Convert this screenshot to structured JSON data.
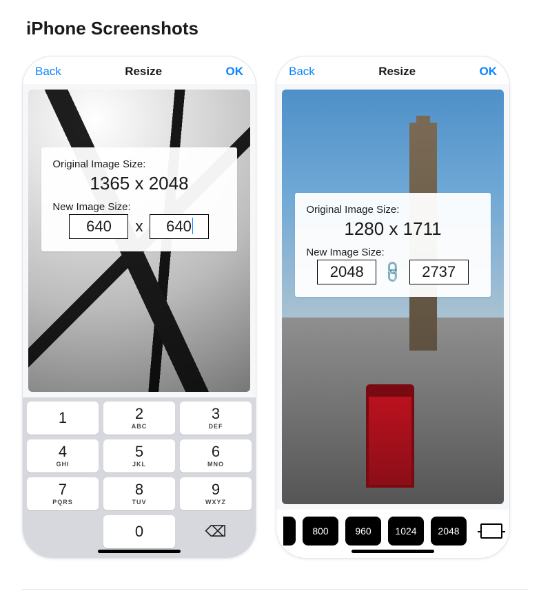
{
  "page": {
    "heading": "iPhone Screenshots"
  },
  "nav": {
    "back": "Back",
    "title": "Resize",
    "ok": "OK"
  },
  "panel": {
    "original_label": "Original Image Size:",
    "new_label": "New Image Size:",
    "x_separator": "x",
    "link_glyph": "🔗"
  },
  "phone1": {
    "original_size": "1365 x 2048",
    "width": "640",
    "height": "640"
  },
  "phone2": {
    "original_size": "1280 x 1711",
    "width": "2048",
    "height": "2737"
  },
  "keypad": {
    "keys": [
      {
        "num": "1",
        "ltr": ""
      },
      {
        "num": "2",
        "ltr": "ABC"
      },
      {
        "num": "3",
        "ltr": "DEF"
      },
      {
        "num": "4",
        "ltr": "GHI"
      },
      {
        "num": "5",
        "ltr": "JKL"
      },
      {
        "num": "6",
        "ltr": "MNO"
      },
      {
        "num": "7",
        "ltr": "PQRS"
      },
      {
        "num": "8",
        "ltr": "TUV"
      },
      {
        "num": "9",
        "ltr": "WXYZ"
      },
      {
        "num": "0",
        "ltr": ""
      }
    ],
    "delete_glyph": "⌫"
  },
  "presets": [
    "800",
    "960",
    "1024",
    "2048"
  ]
}
